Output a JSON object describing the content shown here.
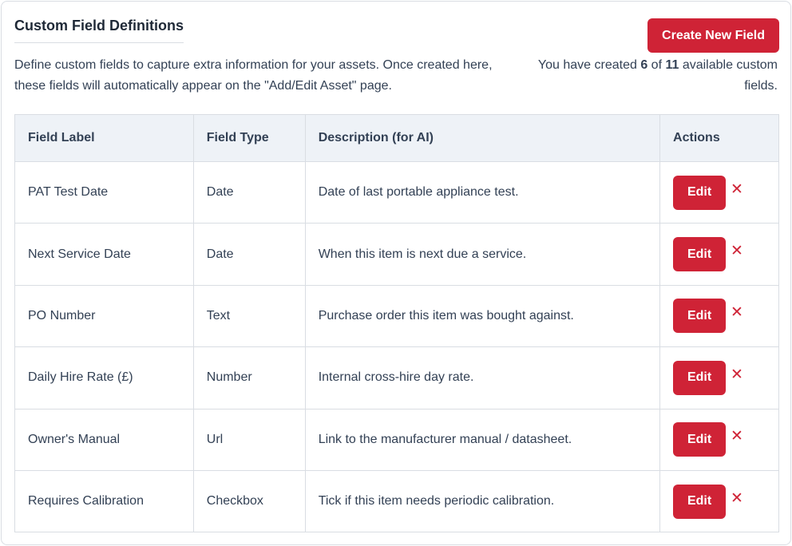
{
  "header": {
    "title": "Custom Field Definitions",
    "create_button": "Create New Field",
    "description": "Define custom fields to capture extra information for your assets. Once created here, these fields will automatically appear on the \"Add/Edit Asset\" page.",
    "quota_prefix": "You have created ",
    "quota_used": "6",
    "quota_mid": " of ",
    "quota_total": "11",
    "quota_suffix": " available custom fields."
  },
  "table": {
    "columns": [
      "Field Label",
      "Field Type",
      "Description (for AI)",
      "Actions"
    ],
    "rows": [
      {
        "label": "PAT Test Date",
        "type": "Date",
        "description": "Date of last portable appliance test."
      },
      {
        "label": "Next Service Date",
        "type": "Date",
        "description": "When this item is next due a service."
      },
      {
        "label": "PO Number",
        "type": "Text",
        "description": "Purchase order this item was bought against."
      },
      {
        "label": "Daily Hire Rate (£)",
        "type": "Number",
        "description": "Internal cross-hire day rate."
      },
      {
        "label": "Owner's Manual",
        "type": "Url",
        "description": "Link to the manufacturer manual / datasheet."
      },
      {
        "label": "Requires Calibration",
        "type": "Checkbox",
        "description": "Tick if this item needs periodic calibration."
      }
    ],
    "edit_label": "Edit",
    "delete_glyph": "✕"
  },
  "colors": {
    "accent": "#cf2336",
    "header_bg": "#eef2f7",
    "border": "#d9dde3",
    "text": "#334155"
  }
}
